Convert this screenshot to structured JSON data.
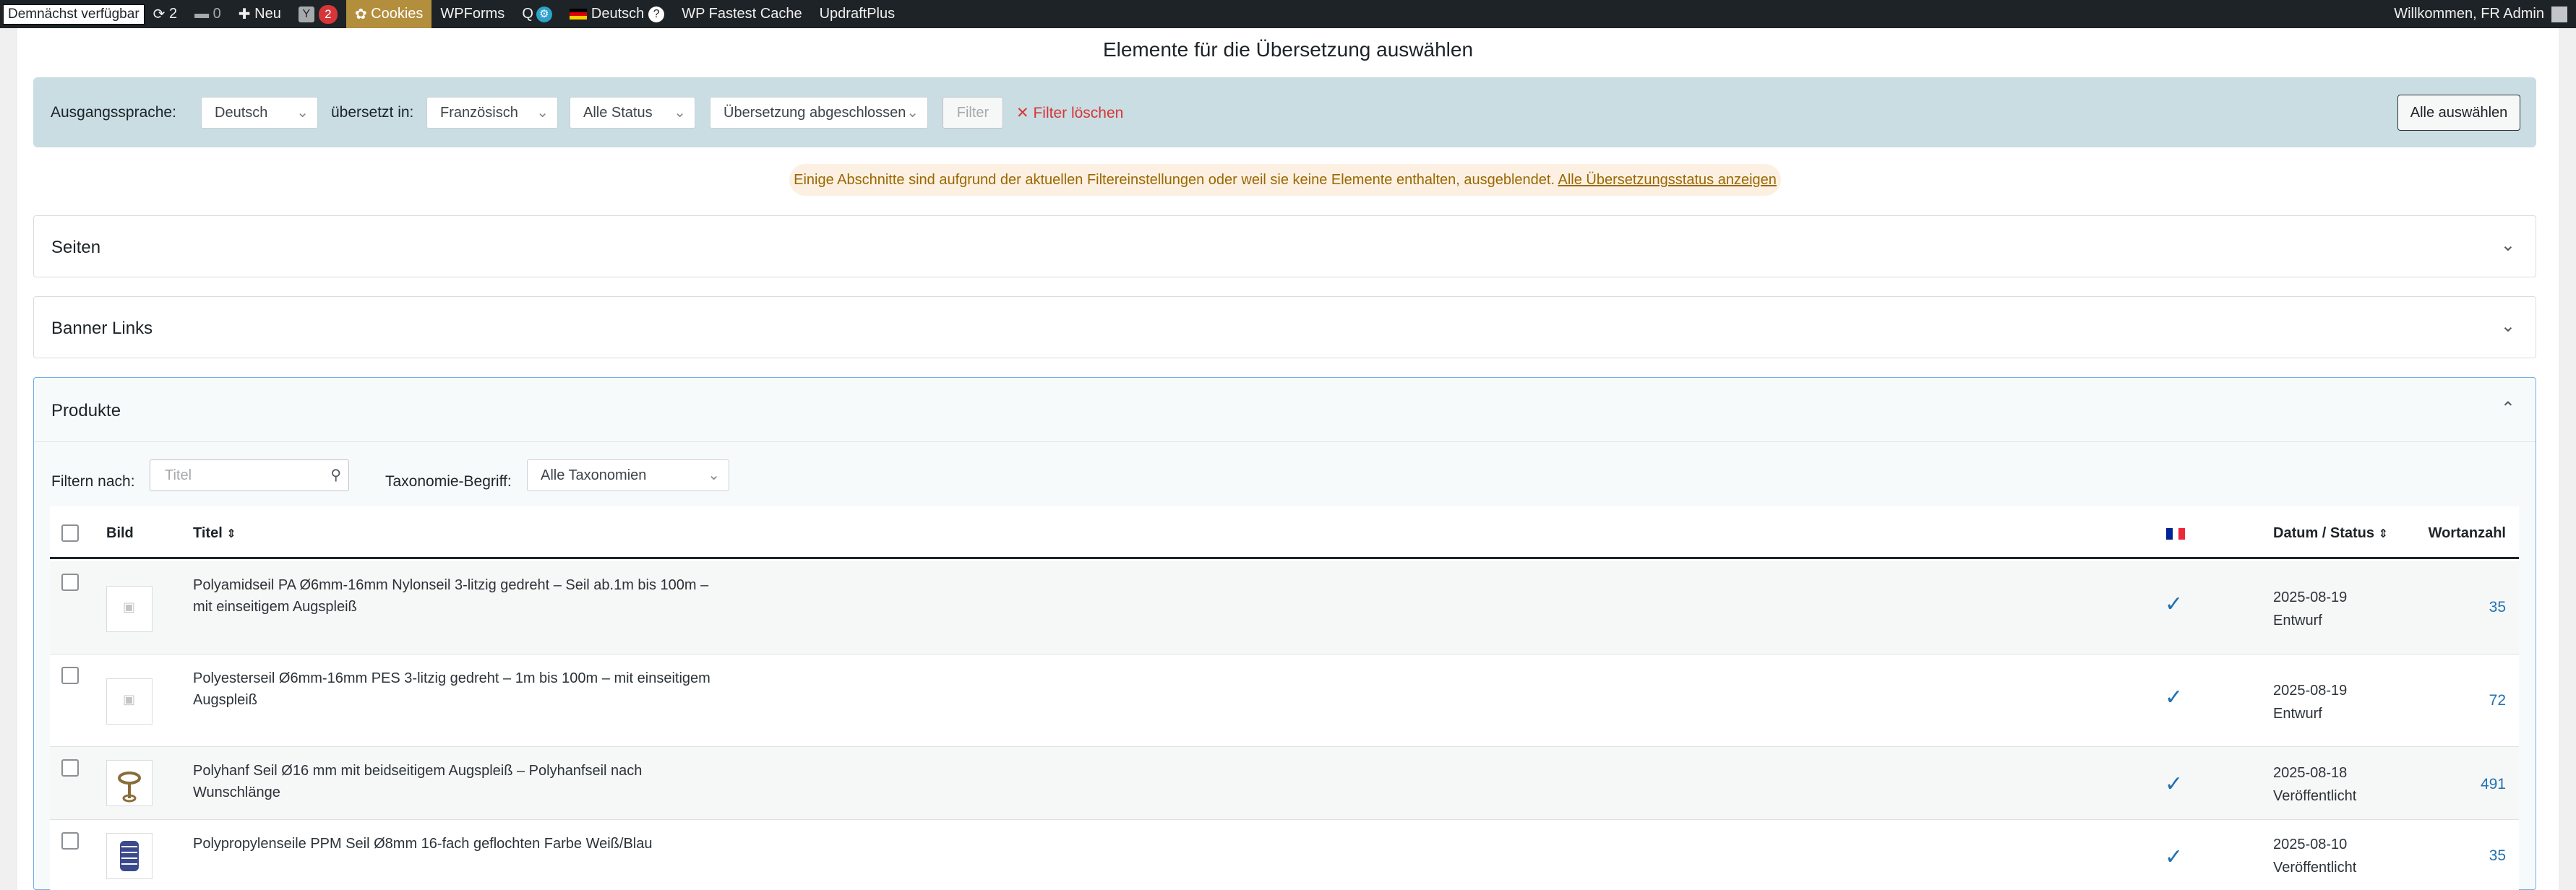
{
  "adminbar": {
    "soon": "Demnächst verfügbar",
    "updates_count": "2",
    "comments_count": "0",
    "new_label": "Neu",
    "yoast_badge": "2",
    "cookies_label": "Cookies",
    "wpforms_label": "WPForms",
    "language_label": "Deutsch",
    "fastest_cache_label": "WP Fastest Cache",
    "updraft_label": "UpdraftPlus",
    "welcome": "Willkommen, FR Admin"
  },
  "page": {
    "title": "Elemente für die Übersetzung auswählen"
  },
  "filters": {
    "source_label": "Ausgangssprache:",
    "source_value": "Deutsch",
    "translated_label": "übersetzt in:",
    "translated_value": "Französisch",
    "status_value": "Alle Status",
    "translation_status_value": "Übersetzung abgeschlossen",
    "filter_button": "Filter",
    "clear_label": "Filter löschen",
    "select_all_button": "Alle auswählen"
  },
  "notice": {
    "text": "Einige Abschnitte sind aufgrund der aktuellen Filtereinstellungen oder weil sie keine Elemente enthalten, ausgeblendet.",
    "link": "Alle Übersetzungsstatus anzeigen"
  },
  "sections": {
    "pages": "Seiten",
    "banner_links": "Banner Links",
    "products": "Produkte"
  },
  "products": {
    "filter_by_label": "Filtern nach:",
    "title_placeholder": "Titel",
    "taxonomy_label": "Taxonomie-Begriff:",
    "taxonomy_value": "Alle Taxonomien",
    "columns": {
      "image": "Bild",
      "title": "Titel",
      "date_status": "Datum / Status",
      "word_count": "Wortanzahl"
    },
    "rows": [
      {
        "title": "Polyamidseil PA Ø6mm-16mm Nylonseil 3-litzig gedreht – Seil ab.1m bis 100m – mit einseitigem Augspleiß",
        "date": "2025-08-19",
        "status": "Entwurf",
        "words": "35"
      },
      {
        "title": "Polyesterseil Ø6mm-16mm PES 3-litzig gedreht – 1m bis 100m – mit einseitigem Augspleiß",
        "date": "2025-08-19",
        "status": "Entwurf",
        "words": "72"
      },
      {
        "title": "Polyhanf Seil Ø16 mm mit beidseitigem Augspleiß – Polyhanfseil nach Wunschlänge",
        "date": "2025-08-18",
        "status": "Veröffentlicht",
        "words": "491"
      },
      {
        "title": "Polypropylenseile PPM Seil Ø8mm 16-fach geflochten Farbe Weiß/Blau",
        "date": "2025-08-10",
        "status": "Veröffentlicht",
        "words": "35"
      }
    ]
  },
  "colors": {
    "adminbar_bg": "#1d2327",
    "filterbar_bg": "#c9dde3",
    "accent": "#2271b1",
    "danger": "#d63638"
  }
}
